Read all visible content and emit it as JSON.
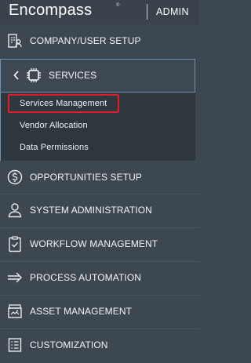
{
  "header": {
    "brand": "Encompass",
    "trademark": "®",
    "admin": "ADMIN"
  },
  "menu": {
    "company_user_setup": {
      "label": "COMPANY/USER SETUP",
      "icon": "building-user-icon"
    },
    "services": {
      "label": "SERVICES",
      "icon": "cpu-chip-icon",
      "expanded": true,
      "sub_items": [
        {
          "label": "Services Management",
          "selected": true
        },
        {
          "label": "Vendor Allocation"
        },
        {
          "label": "Data Permissions"
        }
      ]
    },
    "opportunities_setup": {
      "label": "OPPORTUNITIES SETUP",
      "icon": "dollar-circle-icon"
    },
    "system_administration": {
      "label": "SYSTEM ADMINISTRATION",
      "icon": "person-icon"
    },
    "workflow_management": {
      "label": "WORKFLOW MANAGEMENT",
      "icon": "clipboard-check-icon"
    },
    "process_automation": {
      "label": "PROCESS AUTOMATION",
      "icon": "arrow-right-icon"
    },
    "asset_management": {
      "label": "ASSET MANAGEMENT",
      "icon": "asset-box-icon"
    },
    "customization": {
      "label": "CUSTOMIZATION",
      "icon": "list-document-icon"
    }
  },
  "colors": {
    "background": "#3d4750",
    "submenu_background": "#2e363e",
    "active_border": "#6b8fb3",
    "highlight": "#e21b2b",
    "text": "#f2f4f5"
  }
}
